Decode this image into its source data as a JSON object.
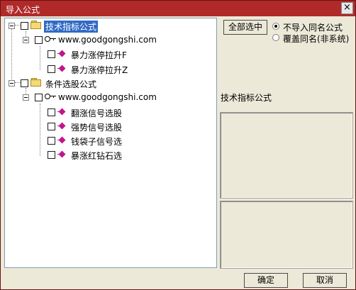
{
  "window": {
    "title": "导入公式",
    "close_glyph": "×"
  },
  "tree": {
    "groups": [
      {
        "label": "技术指标公式",
        "source": "www.goodgongshi.com",
        "items": [
          "暴力涨停拉升F",
          "暴力涨停拉升Z"
        ]
      },
      {
        "label": "条件选股公式",
        "source": "www.goodgongshi.com",
        "items": [
          "翻涨信号选股",
          "强势信号选股",
          "钱袋子信号选",
          "暴涨红钻石选"
        ]
      }
    ]
  },
  "buttons": {
    "select_all": "全部选中",
    "ok": "确定",
    "cancel": "取消"
  },
  "options": {
    "no_import": "不导入同名公式",
    "overwrite": "覆盖同名(非系统)",
    "selected": "no_import"
  },
  "info": {
    "type_label": "技术指标公式"
  },
  "colors": {
    "titlebar": "#b02a2a",
    "selection": "#316ac5",
    "formula_icon": "#c4138f"
  }
}
